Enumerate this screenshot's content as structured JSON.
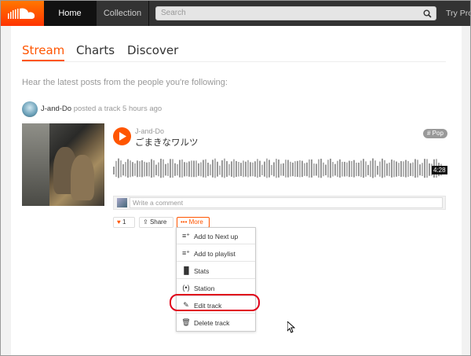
{
  "topbar": {
    "home": "Home",
    "collection": "Collection",
    "search_placeholder": "Search",
    "try_pro": "Try Pro"
  },
  "tabs": [
    {
      "label": "Stream"
    },
    {
      "label": "Charts"
    },
    {
      "label": "Discover"
    }
  ],
  "subtitle": "Hear the latest posts from the people you're following:",
  "post": {
    "user": "J-and-Do",
    "action": "posted a track 5 hours ago"
  },
  "track": {
    "user": "J-and-Do",
    "title": "ごまきなワルツ",
    "tag": "# Pop",
    "duration": "4:28",
    "comment_placeholder": "Write a comment"
  },
  "actions": {
    "like_count": "1",
    "share": "Share",
    "more": "More"
  },
  "menu": [
    {
      "label": "Add to Next up",
      "icon": "add-to-next-up-icon"
    },
    {
      "label": "Add to playlist",
      "icon": "add-to-playlist-icon"
    },
    {
      "label": "Stats",
      "icon": "stats-icon"
    },
    {
      "label": "Station",
      "icon": "station-icon"
    },
    {
      "label": "Edit track",
      "icon": "pencil-icon"
    },
    {
      "label": "Delete track",
      "icon": "trash-icon"
    }
  ],
  "colors": {
    "accent": "#ff5500",
    "highlight": "#e0001a",
    "topbar": "#333333"
  }
}
